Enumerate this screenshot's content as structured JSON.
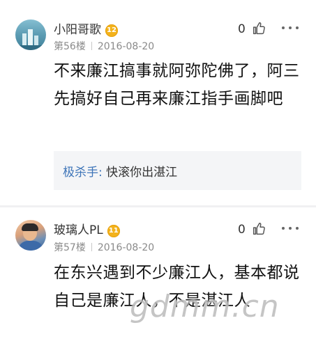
{
  "comments": [
    {
      "username": "小阳哥歌",
      "level": "12",
      "floor": "第56楼",
      "date": "2016-08-20",
      "likes": "0",
      "text": "不来廉江搞事就阿弥陀佛了，阿三先搞好自己再来廉江指手画脚吧",
      "quote": {
        "author": "极杀手:",
        "text": "快滚你出湛江"
      }
    },
    {
      "username": "玻璃人PL",
      "level": "11",
      "floor": "第57楼",
      "date": "2016-08-20",
      "likes": "0",
      "text": "在东兴遇到不少廉江人，基本都说自己是廉江人，不是湛江人"
    }
  ],
  "watermark": "gdmm.cn",
  "icons": {
    "like": "thumbs-up-icon",
    "more": "more-dots-icon",
    "level": "level-badge-icon"
  },
  "colors": {
    "quote_author": "#3d74b8",
    "badge": "#f3b21b",
    "meta": "#8a8a8a",
    "quote_bg": "#f4f5f7"
  }
}
